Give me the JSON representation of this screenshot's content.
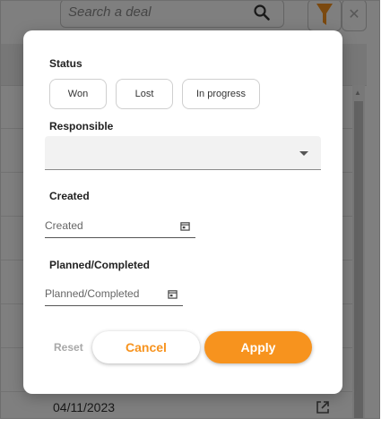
{
  "search": {
    "placeholder": "Search a deal"
  },
  "toolbar": {
    "filter_icon": "funnel-icon",
    "close_label": "✕"
  },
  "table": {
    "last_row_date": "04/11/2023"
  },
  "filter_dialog": {
    "status_label": "Status",
    "status_options": [
      "Won",
      "Lost",
      "In progress"
    ],
    "responsible_label": "Responsible",
    "responsible_value": "",
    "created_label": "Created",
    "created_placeholder": "Created",
    "planned_label": "Planned/Completed",
    "planned_placeholder": "Planned/Completed",
    "reset_label": "Reset",
    "cancel_label": "Cancel",
    "apply_label": "Apply"
  },
  "colors": {
    "accent": "#f7931e",
    "overlay": "rgba(0,0,0,0.5)"
  }
}
